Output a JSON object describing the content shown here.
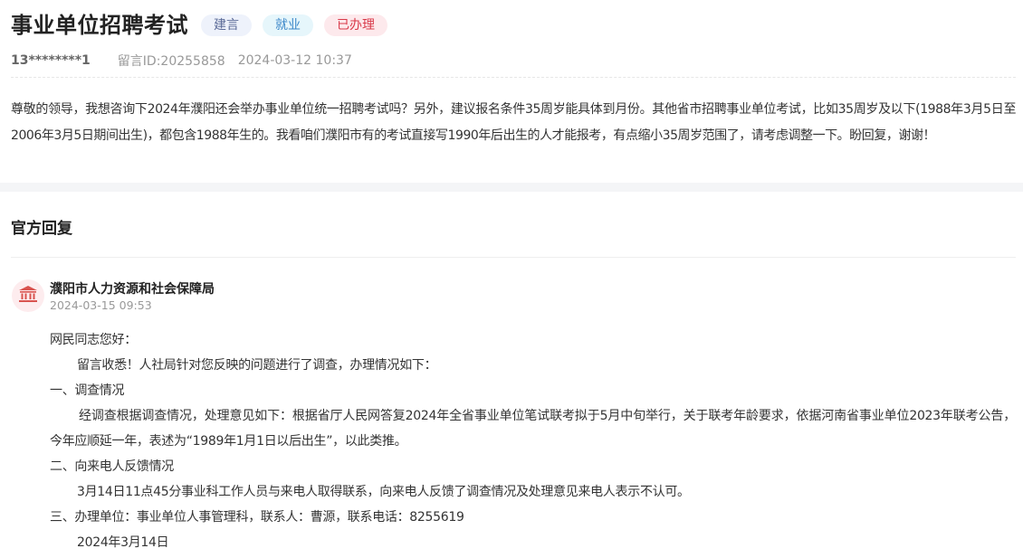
{
  "header": {
    "title": "事业单位招聘考试",
    "tags": [
      "建言",
      "就业",
      "已办理"
    ]
  },
  "meta": {
    "user": "13********1",
    "message_id": "留言ID:20255858",
    "datetime": "2024-03-12 10:37"
  },
  "question": {
    "text": "尊敬的领导，我想咨询下2024年濮阳还会举办事业单位统一招聘考试吗？另外，建议报名条件35周岁能具体到月份。其他省市招聘事业单位考试，比如35周岁及以下(1988年3月5日至2006年3月5日期间出生)，都包含1988年生的。我看咱们濮阳市有的考试直接写1990年后出生的人才能报考，有点缩小35周岁范围了，请考虑调整一下。盼回复，谢谢！"
  },
  "reply": {
    "heading": "官方回复",
    "department": "濮阳市人力资源和社会保障局",
    "time": "2024-03-15 09:53",
    "icon": "government-building-icon",
    "lines": {
      "greeting": "网民同志您好：",
      "intro": "留言收悉！人社局针对您反映的问题进行了调查，办理情况如下：",
      "s1_title": "一、调查情况",
      "s1_body": "经调查根据调查情况，处理意见如下：根据省厅人民网答复2024年全省事业单位笔试联考拟于5月中旬举行，关于联考年龄要求，依据河南省事业单位2023年联考公告，今年应顺延一年，表述为“1989年1月1日以后出生”，以此类推。",
      "s2_title": "二、向来电人反馈情况",
      "s2_body": "3月14日11点45分事业科工作人员与来电人取得联系，向来电人反馈了调查情况及处理意见来电人表示不认可。",
      "s3_title": "三、办理单位：事业单位人事管理科，联系人：曹源，联系电话：8255619",
      "date": "2024年3月14日"
    }
  },
  "colors": {
    "tag_blue_bg": "#eef2fb",
    "tag_cyan_bg": "#e6f6fb",
    "tag_red_bg": "#fde9ec",
    "tag_red_text": "#d93a4a",
    "icon_red": "#d9534f"
  }
}
